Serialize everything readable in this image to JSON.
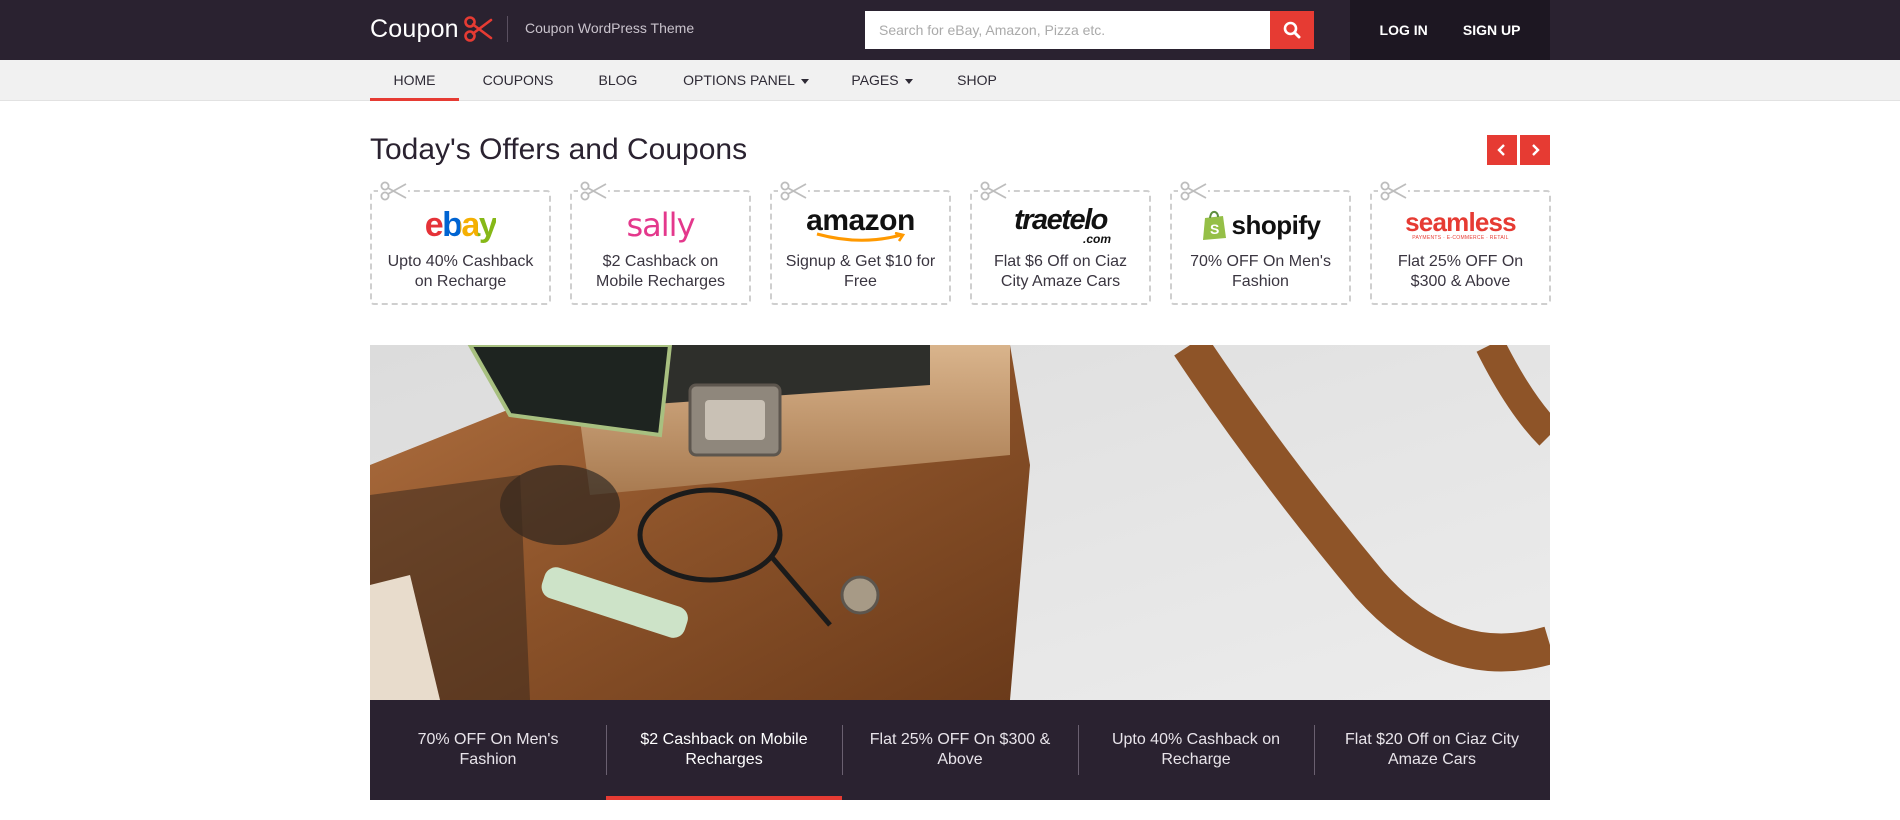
{
  "header": {
    "logo_text": "Coupon",
    "tagline": "Coupon WordPress Theme",
    "search_placeholder": "Search for eBay, Amazon, Pizza etc.",
    "login_label": "LOG IN",
    "signup_label": "SIGN UP"
  },
  "nav": {
    "items": [
      {
        "label": "HOME",
        "active": true
      },
      {
        "label": "COUPONS"
      },
      {
        "label": "BLOG"
      },
      {
        "label": "OPTIONS PANEL",
        "dropdown": true
      },
      {
        "label": "PAGES",
        "dropdown": true
      },
      {
        "label": "SHOP"
      }
    ]
  },
  "offers": {
    "title": "Today's Offers and Coupons",
    "cards": [
      {
        "brand": "ebay",
        "caption": "Upto 40% Cashback on Recharge"
      },
      {
        "brand": "sally",
        "caption": "$2 Cashback on Mobile Recharges"
      },
      {
        "brand": "amazon",
        "caption": "Signup & Get $10 for Free"
      },
      {
        "brand": "traetelo",
        "brand_sub": ".com",
        "caption": "Flat $6 Off on Ciaz City Amaze Cars"
      },
      {
        "brand": "shopify",
        "caption": "70% OFF On Men's Fashion"
      },
      {
        "brand": "seamless",
        "brand_sub": "PAYMENTS · E-COMMERCE · RETAIL",
        "caption": "Flat 25% OFF On $300 & Above"
      }
    ]
  },
  "slider": {
    "tabs": [
      {
        "label": "70% OFF On Men's Fashion"
      },
      {
        "label": "$2 Cashback on Mobile Recharges",
        "active": true
      },
      {
        "label": "Flat 25% OFF On $300 & Above"
      },
      {
        "label": "Upto 40% Cashback on Recharge"
      },
      {
        "label": "Flat $20 Off on Ciaz City Amaze Cars"
      }
    ]
  },
  "colors": {
    "brand_dark": "#2a2230",
    "accent": "#e63b33"
  },
  "icons": [
    "scissors-icon",
    "search-icon",
    "chevron-left-icon",
    "chevron-right-icon",
    "caret-down-icon"
  ]
}
